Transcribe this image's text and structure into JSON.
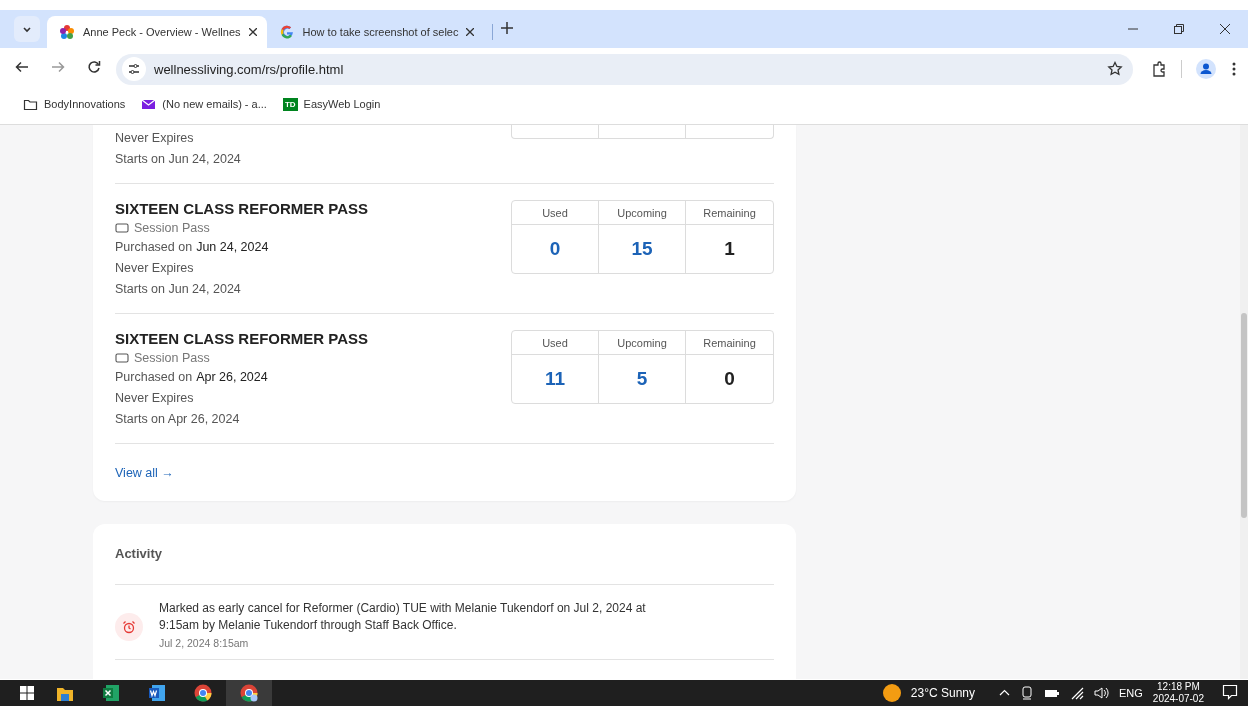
{
  "browser": {
    "tabs": [
      {
        "title": "Anne Peck - Overview - Wellnes",
        "selected": true
      },
      {
        "title": "How to take screenshot of selec",
        "selected": false
      }
    ],
    "address": "wellnessliving.com/rs/profile.html",
    "bookmarks": [
      {
        "label": "BodyInnovations"
      },
      {
        "label": "(No new emails) - a..."
      },
      {
        "label": "EasyWeb Login"
      }
    ],
    "bookmark_badge": "TD"
  },
  "passes": [
    {
      "partial": true,
      "lines": [
        "Never Expires",
        "Starts on Jun 24, 2024"
      ]
    },
    {
      "partial": false,
      "title": "SIXTEEN CLASS REFORMER PASS",
      "type": "Session Pass",
      "purchased_label": "Purchased on",
      "purchased_date": "Jun 24, 2024",
      "lines": [
        "Never Expires",
        "Starts on Jun 24, 2024"
      ],
      "stats": [
        {
          "label": "Used",
          "value": "0",
          "kind": "accent"
        },
        {
          "label": "Upcoming",
          "value": "15",
          "kind": "accent"
        },
        {
          "label": "Remaining",
          "value": "1",
          "kind": "plain"
        }
      ]
    },
    {
      "partial": false,
      "title": "SIXTEEN CLASS REFORMER PASS",
      "type": "Session Pass",
      "purchased_label": "Purchased on",
      "purchased_date": "Apr 26, 2024",
      "lines": [
        "Never Expires",
        "Starts on Apr 26, 2024"
      ],
      "stats": [
        {
          "label": "Used",
          "value": "11",
          "kind": "accent"
        },
        {
          "label": "Upcoming",
          "value": "5",
          "kind": "accent"
        },
        {
          "label": "Remaining",
          "value": "0",
          "kind": "plain"
        }
      ]
    }
  ],
  "view_all": "View all →",
  "activity": {
    "title": "Activity",
    "items": [
      {
        "text": "Marked as early cancel for Reformer (Cardio) TUE with Melanie Tukendorf on Jul 2, 2024 at 9:15am by Melanie Tukendorf through Staff Back Office.",
        "time": "Jul 2, 2024 8:15am"
      }
    ]
  },
  "taskbar": {
    "weather": "23°C  Sunny",
    "language": "ENG",
    "time": "12:18 PM",
    "date": "2024-07-02"
  }
}
